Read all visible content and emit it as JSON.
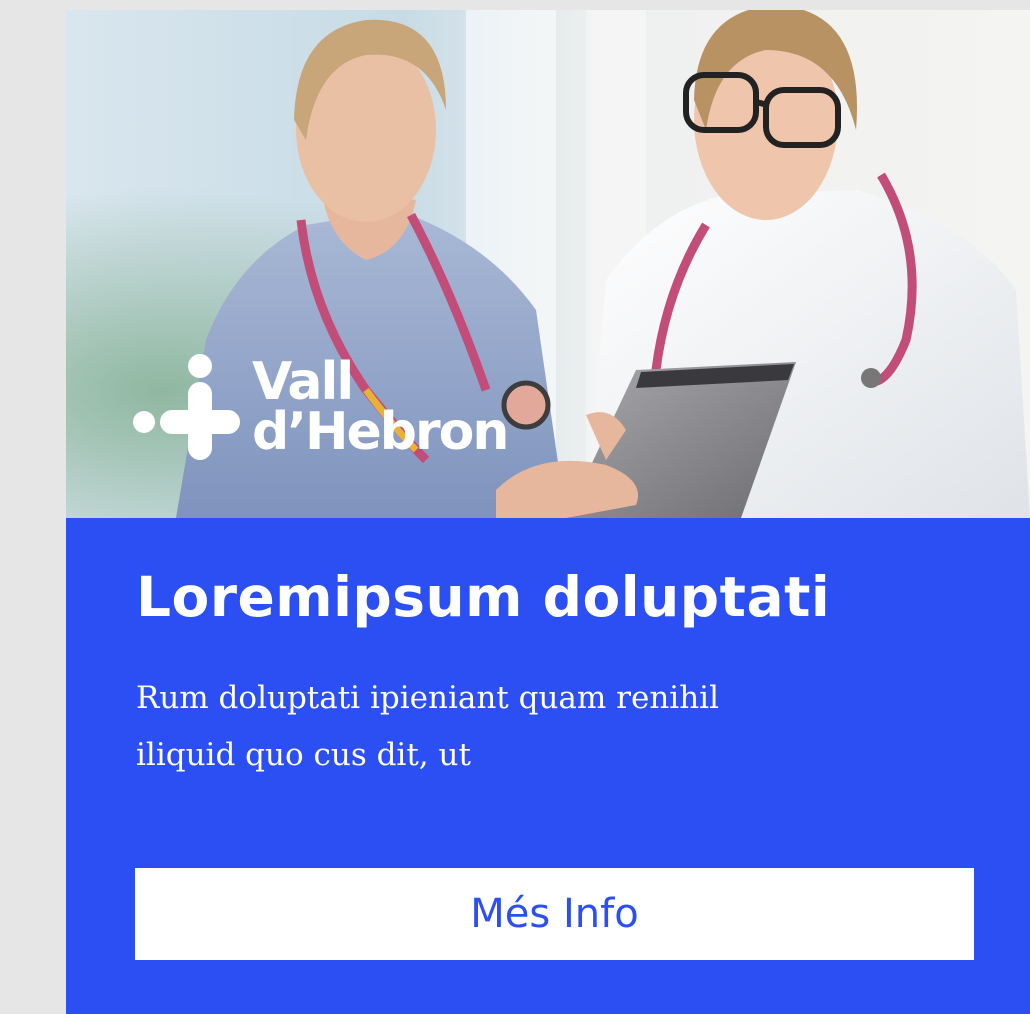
{
  "colors": {
    "page_background": "#e6e6e6",
    "panel_background": "#2b4ff3",
    "accent_text": "#2b4ff3",
    "text_on_panel": "#ffffff"
  },
  "hero": {
    "image": "two-doctors-with-tablet-photo",
    "logo": {
      "icon": "vall-dhebron-cross-icon",
      "line1": "Vall",
      "line2": "d’Hebron"
    }
  },
  "panel": {
    "title": "Loremipsum doluptati",
    "description_line1": "Rum doluptati ipieniant quam renihil",
    "description_line2": "iliquid quo cus dit, ut",
    "cta_label": "Més Info"
  }
}
